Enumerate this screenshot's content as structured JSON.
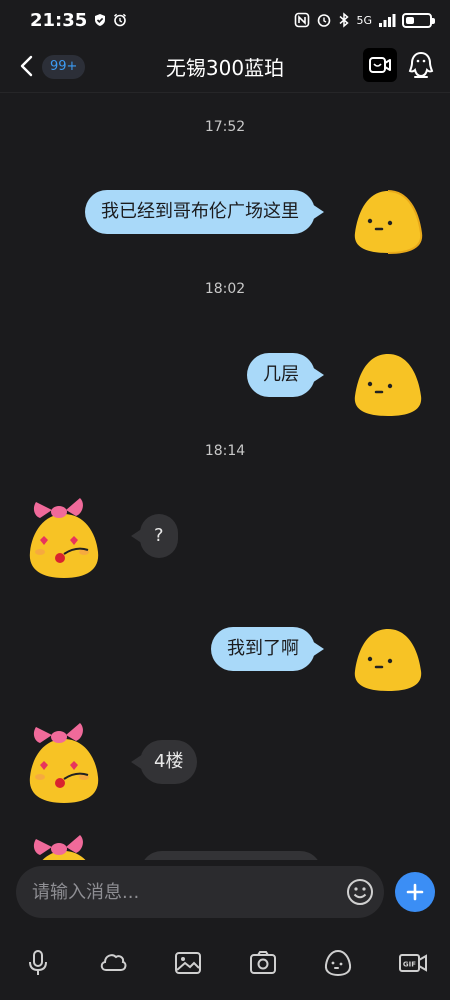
{
  "status_bar": {
    "time": "21:35",
    "network": "5G",
    "battery_level": 0.35
  },
  "header": {
    "unread_badge": "99+",
    "title": "无锡300蓝珀"
  },
  "messages": [
    {
      "type": "time",
      "text": "17:52"
    },
    {
      "type": "outgoing",
      "text": "我已经到哥布伦广场这里"
    },
    {
      "type": "time",
      "text": "18:02"
    },
    {
      "type": "outgoing",
      "text": "几层"
    },
    {
      "type": "time",
      "text": "18:14"
    },
    {
      "type": "incoming",
      "text": "?"
    },
    {
      "type": "outgoing",
      "text": "我到了啊"
    },
    {
      "type": "incoming",
      "text": "4楼"
    }
  ],
  "input": {
    "placeholder": "请输入消息..."
  },
  "toolbar": {
    "items": [
      "microphone-icon",
      "cloud-icon",
      "image-icon",
      "camera-icon",
      "sticker-icon",
      "gif-icon"
    ]
  },
  "colors": {
    "background": "#1b1b1d",
    "outgoing_bubble": "#a9d9f9",
    "incoming_bubble": "#333336",
    "accent": "#3b8ef5",
    "badge_text": "#3d9cf4"
  }
}
